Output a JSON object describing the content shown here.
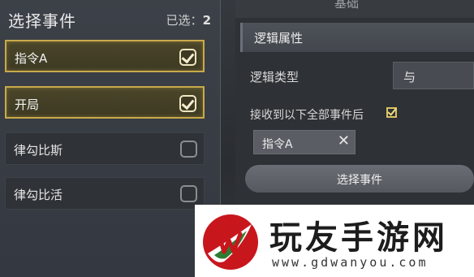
{
  "left_panel": {
    "title": "选择事件",
    "selected_count_label": "已选：",
    "selected_count": "2",
    "events": [
      {
        "label": "指令A",
        "checked": true
      },
      {
        "label": "开局",
        "checked": true
      },
      {
        "label": "律勾比斯",
        "checked": false
      },
      {
        "label": "律勾比活",
        "checked": false
      }
    ]
  },
  "right_panel": {
    "top_tab": "基础",
    "section_title": "逻辑属性",
    "logic_type_label": "逻辑类型",
    "logic_type_value": "与",
    "receive_all_label": "接收到以下全部事件后",
    "tag_label": "指令A",
    "tag_remove_glyph": "✕",
    "select_event_button": "选择事件"
  },
  "watermark": {
    "name": "玩友手游网",
    "url": "www.gdwanyou.com"
  },
  "colors": {
    "selected_border": "#c9a94a",
    "panel_bg": "#3c4148",
    "logo_red": "#c8161d",
    "logo_green": "#2e7d32"
  }
}
